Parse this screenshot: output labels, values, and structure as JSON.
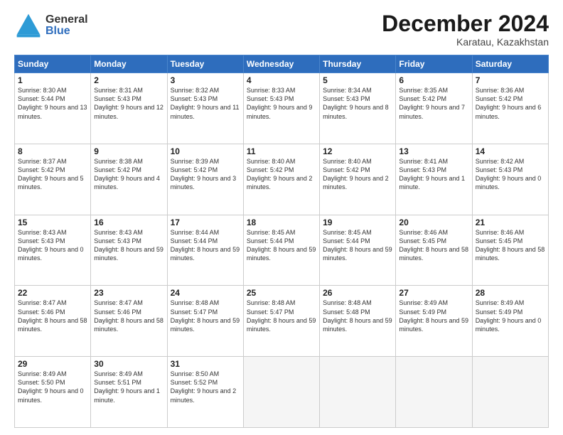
{
  "header": {
    "logo_general": "General",
    "logo_blue": "Blue",
    "title": "December 2024",
    "subtitle": "Karatau, Kazakhstan"
  },
  "days_of_week": [
    "Sunday",
    "Monday",
    "Tuesday",
    "Wednesday",
    "Thursday",
    "Friday",
    "Saturday"
  ],
  "weeks": [
    [
      {
        "day": "1",
        "sunrise": "Sunrise: 8:30 AM",
        "sunset": "Sunset: 5:44 PM",
        "daylight": "Daylight: 9 hours and 13 minutes."
      },
      {
        "day": "2",
        "sunrise": "Sunrise: 8:31 AM",
        "sunset": "Sunset: 5:43 PM",
        "daylight": "Daylight: 9 hours and 12 minutes."
      },
      {
        "day": "3",
        "sunrise": "Sunrise: 8:32 AM",
        "sunset": "Sunset: 5:43 PM",
        "daylight": "Daylight: 9 hours and 11 minutes."
      },
      {
        "day": "4",
        "sunrise": "Sunrise: 8:33 AM",
        "sunset": "Sunset: 5:43 PM",
        "daylight": "Daylight: 9 hours and 9 minutes."
      },
      {
        "day": "5",
        "sunrise": "Sunrise: 8:34 AM",
        "sunset": "Sunset: 5:43 PM",
        "daylight": "Daylight: 9 hours and 8 minutes."
      },
      {
        "day": "6",
        "sunrise": "Sunrise: 8:35 AM",
        "sunset": "Sunset: 5:42 PM",
        "daylight": "Daylight: 9 hours and 7 minutes."
      },
      {
        "day": "7",
        "sunrise": "Sunrise: 8:36 AM",
        "sunset": "Sunset: 5:42 PM",
        "daylight": "Daylight: 9 hours and 6 minutes."
      }
    ],
    [
      {
        "day": "8",
        "sunrise": "Sunrise: 8:37 AM",
        "sunset": "Sunset: 5:42 PM",
        "daylight": "Daylight: 9 hours and 5 minutes."
      },
      {
        "day": "9",
        "sunrise": "Sunrise: 8:38 AM",
        "sunset": "Sunset: 5:42 PM",
        "daylight": "Daylight: 9 hours and 4 minutes."
      },
      {
        "day": "10",
        "sunrise": "Sunrise: 8:39 AM",
        "sunset": "Sunset: 5:42 PM",
        "daylight": "Daylight: 9 hours and 3 minutes."
      },
      {
        "day": "11",
        "sunrise": "Sunrise: 8:40 AM",
        "sunset": "Sunset: 5:42 PM",
        "daylight": "Daylight: 9 hours and 2 minutes."
      },
      {
        "day": "12",
        "sunrise": "Sunrise: 8:40 AM",
        "sunset": "Sunset: 5:42 PM",
        "daylight": "Daylight: 9 hours and 2 minutes."
      },
      {
        "day": "13",
        "sunrise": "Sunrise: 8:41 AM",
        "sunset": "Sunset: 5:43 PM",
        "daylight": "Daylight: 9 hours and 1 minute."
      },
      {
        "day": "14",
        "sunrise": "Sunrise: 8:42 AM",
        "sunset": "Sunset: 5:43 PM",
        "daylight": "Daylight: 9 hours and 0 minutes."
      }
    ],
    [
      {
        "day": "15",
        "sunrise": "Sunrise: 8:43 AM",
        "sunset": "Sunset: 5:43 PM",
        "daylight": "Daylight: 9 hours and 0 minutes."
      },
      {
        "day": "16",
        "sunrise": "Sunrise: 8:43 AM",
        "sunset": "Sunset: 5:43 PM",
        "daylight": "Daylight: 8 hours and 59 minutes."
      },
      {
        "day": "17",
        "sunrise": "Sunrise: 8:44 AM",
        "sunset": "Sunset: 5:44 PM",
        "daylight": "Daylight: 8 hours and 59 minutes."
      },
      {
        "day": "18",
        "sunrise": "Sunrise: 8:45 AM",
        "sunset": "Sunset: 5:44 PM",
        "daylight": "Daylight: 8 hours and 59 minutes."
      },
      {
        "day": "19",
        "sunrise": "Sunrise: 8:45 AM",
        "sunset": "Sunset: 5:44 PM",
        "daylight": "Daylight: 8 hours and 59 minutes."
      },
      {
        "day": "20",
        "sunrise": "Sunrise: 8:46 AM",
        "sunset": "Sunset: 5:45 PM",
        "daylight": "Daylight: 8 hours and 58 minutes."
      },
      {
        "day": "21",
        "sunrise": "Sunrise: 8:46 AM",
        "sunset": "Sunset: 5:45 PM",
        "daylight": "Daylight: 8 hours and 58 minutes."
      }
    ],
    [
      {
        "day": "22",
        "sunrise": "Sunrise: 8:47 AM",
        "sunset": "Sunset: 5:46 PM",
        "daylight": "Daylight: 8 hours and 58 minutes."
      },
      {
        "day": "23",
        "sunrise": "Sunrise: 8:47 AM",
        "sunset": "Sunset: 5:46 PM",
        "daylight": "Daylight: 8 hours and 58 minutes."
      },
      {
        "day": "24",
        "sunrise": "Sunrise: 8:48 AM",
        "sunset": "Sunset: 5:47 PM",
        "daylight": "Daylight: 8 hours and 59 minutes."
      },
      {
        "day": "25",
        "sunrise": "Sunrise: 8:48 AM",
        "sunset": "Sunset: 5:47 PM",
        "daylight": "Daylight: 8 hours and 59 minutes."
      },
      {
        "day": "26",
        "sunrise": "Sunrise: 8:48 AM",
        "sunset": "Sunset: 5:48 PM",
        "daylight": "Daylight: 8 hours and 59 minutes."
      },
      {
        "day": "27",
        "sunrise": "Sunrise: 8:49 AM",
        "sunset": "Sunset: 5:49 PM",
        "daylight": "Daylight: 8 hours and 59 minutes."
      },
      {
        "day": "28",
        "sunrise": "Sunrise: 8:49 AM",
        "sunset": "Sunset: 5:49 PM",
        "daylight": "Daylight: 9 hours and 0 minutes."
      }
    ],
    [
      {
        "day": "29",
        "sunrise": "Sunrise: 8:49 AM",
        "sunset": "Sunset: 5:50 PM",
        "daylight": "Daylight: 9 hours and 0 minutes."
      },
      {
        "day": "30",
        "sunrise": "Sunrise: 8:49 AM",
        "sunset": "Sunset: 5:51 PM",
        "daylight": "Daylight: 9 hours and 1 minute."
      },
      {
        "day": "31",
        "sunrise": "Sunrise: 8:50 AM",
        "sunset": "Sunset: 5:52 PM",
        "daylight": "Daylight: 9 hours and 2 minutes."
      },
      null,
      null,
      null,
      null
    ]
  ]
}
